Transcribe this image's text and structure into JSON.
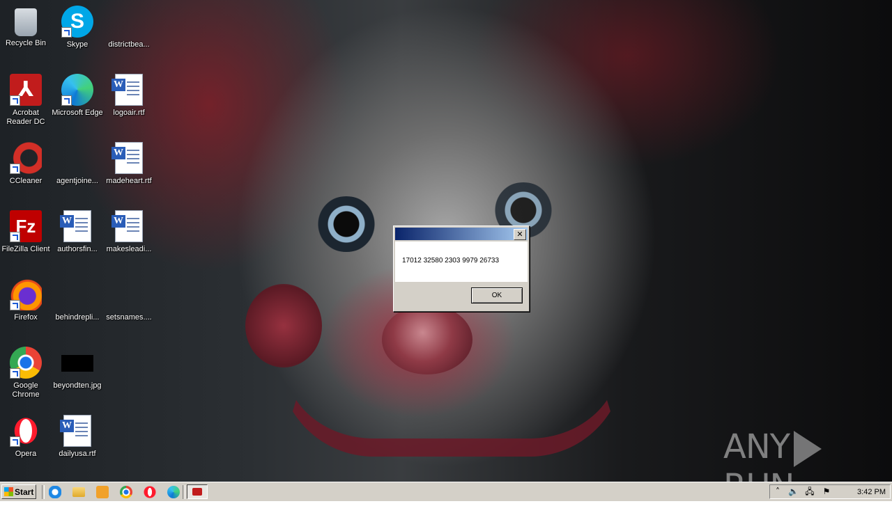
{
  "desktop": {
    "icons": [
      {
        "label": "Recycle Bin",
        "icon": "recycle-bin-icon"
      },
      {
        "label": "Skype",
        "icon": "skype-icon"
      },
      {
        "label": "districtbea...",
        "icon": "blank-file-icon"
      },
      {
        "label": "Acrobat Reader DC",
        "icon": "acrobat-icon"
      },
      {
        "label": "Microsoft Edge",
        "icon": "edge-icon"
      },
      {
        "label": "logoair.rtf",
        "icon": "rtf-document-icon"
      },
      {
        "label": "CCleaner",
        "icon": "ccleaner-icon"
      },
      {
        "label": "agentjoine...",
        "icon": "blank-file-icon"
      },
      {
        "label": "madeheart.rtf",
        "icon": "rtf-document-icon"
      },
      {
        "label": "FileZilla Client",
        "icon": "filezilla-icon"
      },
      {
        "label": "authorsfin...",
        "icon": "rtf-document-icon"
      },
      {
        "label": "makesleadi...",
        "icon": "rtf-document-icon"
      },
      {
        "label": "Firefox",
        "icon": "firefox-icon"
      },
      {
        "label": "behindrepli...",
        "icon": "blank-file-icon"
      },
      {
        "label": "setsnames....",
        "icon": "blank-file-icon"
      },
      {
        "label": "Google Chrome",
        "icon": "chrome-icon"
      },
      {
        "label": "beyondten.jpg",
        "icon": "image-file-icon"
      },
      {
        "label": "Opera",
        "icon": "opera-icon"
      },
      {
        "label": "dailyusa.rtf",
        "icon": "rtf-document-icon"
      }
    ]
  },
  "dialog": {
    "title": "",
    "message": "17012 32580 2303 9979 26733",
    "ok_label": "OK",
    "close_glyph": "✕"
  },
  "watermark": {
    "left": "ANY",
    "right": "RUN"
  },
  "taskbar": {
    "start_label": "Start",
    "quick_launch": [
      "internet-explorer-icon",
      "folder-icon",
      "media-player-icon",
      "chrome-icon",
      "opera-icon",
      "edge-icon"
    ],
    "active_task": "acrobat-task-icon",
    "tray": {
      "time": "3:42 PM",
      "icons": [
        "chevron-up-icon",
        "volume-icon",
        "network-icon",
        "flag-icon"
      ]
    }
  },
  "colors": {
    "titlebar_start": "#0a246a",
    "titlebar_end": "#a6caf0",
    "taskbar": "#d4d0c8"
  }
}
